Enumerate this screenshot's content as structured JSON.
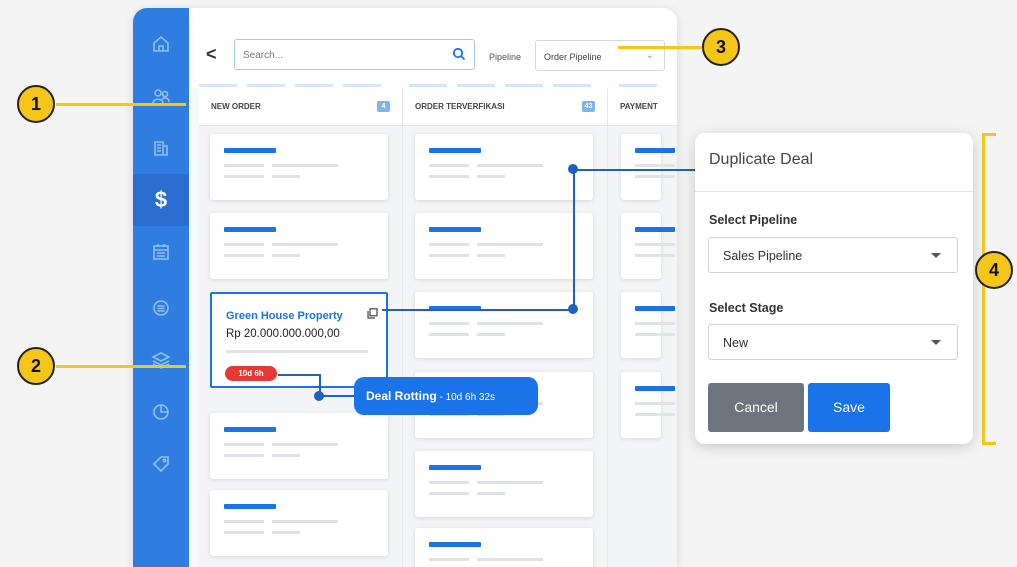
{
  "sidebar": {
    "icons": [
      "home-icon",
      "users-icon",
      "building-icon",
      "dollar-icon",
      "calendar-icon",
      "list-icon",
      "layers-icon",
      "pie-chart-icon",
      "tag-icon"
    ],
    "active": "dollar-icon",
    "dollar_glyph": "$"
  },
  "topbar": {
    "back_glyph": "<",
    "search_placeholder": "Search...",
    "pipeline_label": "Pipeline",
    "pipeline_value": "Order Pipeline"
  },
  "columns": [
    {
      "title": "NEW ORDER",
      "count": "4"
    },
    {
      "title": "ORDER TERVERFIKASI",
      "count": "43"
    },
    {
      "title": "PAYMENT",
      "count": ""
    }
  ],
  "deal": {
    "name": "Green House Property",
    "amount": "Rp 20.000.000.000,00",
    "rotting_badge": "10d 6h"
  },
  "rotting_bubble": {
    "label": "Deal Rotting",
    "separator": " - ",
    "time": "10d 6h 32s"
  },
  "dialog": {
    "title": "Duplicate Deal",
    "pipeline_label": "Select Pipeline",
    "pipeline_value": "Sales Pipeline",
    "stage_label": "Select Stage",
    "stage_value": "New",
    "cancel_label": "Cancel",
    "save_label": "Save"
  },
  "callouts": [
    "1",
    "2",
    "3",
    "4"
  ],
  "colors": {
    "sidebar": "#2f7de1",
    "accent": "#1a73e8",
    "callout": "#f5c518",
    "rotting": "#e53935",
    "cancel": "#6c757d"
  }
}
